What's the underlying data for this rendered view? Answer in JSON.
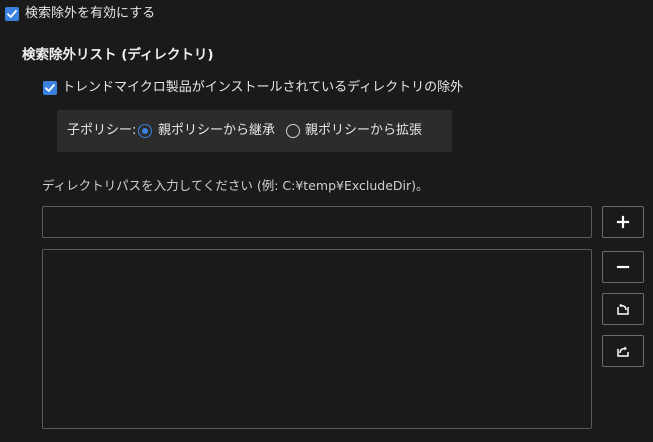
{
  "settings": {
    "enable_exclusion_label": "検索除外を有効にする",
    "enable_exclusion_checked": true,
    "section_title": "検索除外リスト (ディレクトリ)",
    "exclude_trend_label": "トレンドマイクロ製品がインストールされているディレクトリの除外",
    "exclude_trend_checked": true,
    "child_policy": {
      "label": "子ポリシー:",
      "options": [
        "親ポリシーから継承",
        "親ポリシーから拡張"
      ],
      "selected": "親ポリシーから継承"
    },
    "path_hint": "ディレクトリパスを入力してください (例: C:¥temp¥ExcludeDir)。",
    "path_input_value": "",
    "directory_list": [],
    "buttons": {
      "add": "plus-icon",
      "remove": "minus-icon",
      "import": "import-icon",
      "export": "export-icon"
    },
    "accent_color": "#3b82e0"
  }
}
